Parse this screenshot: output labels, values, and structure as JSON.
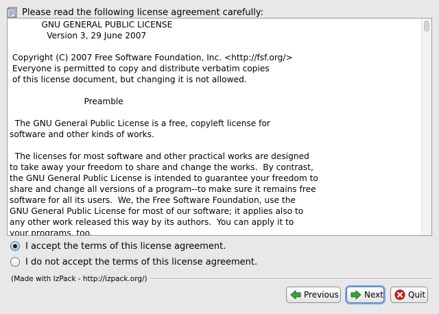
{
  "header": {
    "icon": "document-icon",
    "text": "Please read the following license agreement carefully:"
  },
  "license": {
    "text": "            GNU GENERAL PUBLIC LICENSE\n              Version 3, 29 June 2007\n\n Copyright (C) 2007 Free Software Foundation, Inc. <http://fsf.org/>\n Everyone is permitted to copy and distribute verbatim copies\n of this license document, but changing it is not allowed.\n\n                            Preamble\n\n  The GNU General Public License is a free, copyleft license for\nsoftware and other kinds of works.\n\n  The licenses for most software and other practical works are designed\nto take away your freedom to share and change the works.  By contrast,\nthe GNU General Public License is intended to guarantee your freedom to\nshare and change all versions of a program--to make sure it remains free\nsoftware for all its users.  We, the Free Software Foundation, use the\nGNU General Public License for most of our software; it applies also to\nany other work released this way by its authors.  You can apply it to\nyour programs, too."
  },
  "options": {
    "accept_label": "I accept the terms of this license agreement.",
    "decline_label": "I do not accept the terms of this license agreement.",
    "selected": "accept"
  },
  "footer": {
    "made_with": "(Made with IzPack - http://izpack.org/)"
  },
  "buttons": {
    "previous": "Previous",
    "next": "Next",
    "quit": "Quit"
  },
  "colors": {
    "previous_icon": "#3aa33a",
    "next_icon": "#3aa33a",
    "quit_icon": "#cc2222"
  }
}
